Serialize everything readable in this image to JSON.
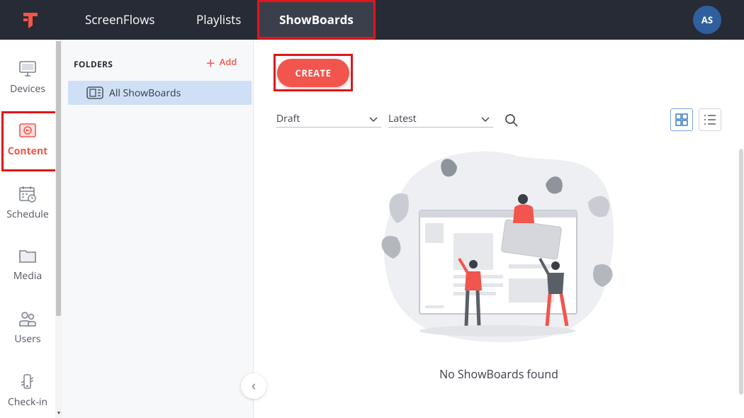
{
  "nav": {
    "tabs": [
      {
        "label": "ScreenFlows"
      },
      {
        "label": "Playlists"
      },
      {
        "label": "ShowBoards"
      }
    ],
    "user_initials": "AS"
  },
  "rail": {
    "items": [
      {
        "label": "Devices",
        "icon": "monitor-icon"
      },
      {
        "label": "Content",
        "icon": "content-icon"
      },
      {
        "label": "Schedule",
        "icon": "calendar-icon"
      },
      {
        "label": "Media",
        "icon": "folder-icon"
      },
      {
        "label": "Users",
        "icon": "users-icon"
      },
      {
        "label": "Check-in",
        "icon": "check-in-icon"
      }
    ],
    "active": "Content"
  },
  "folders": {
    "title": "FOLDERS",
    "add_label": "Add",
    "items": [
      {
        "label": "All ShowBoards"
      }
    ]
  },
  "main": {
    "create_label": "CREATE",
    "status_filter": "Draft",
    "sort_filter": "Latest",
    "empty_message": "No ShowBoards found"
  },
  "colors": {
    "accent": "#f1554d",
    "nav_bg": "#272b35",
    "highlight": "#e0161c",
    "selected_folder": "#cfe0f6"
  }
}
